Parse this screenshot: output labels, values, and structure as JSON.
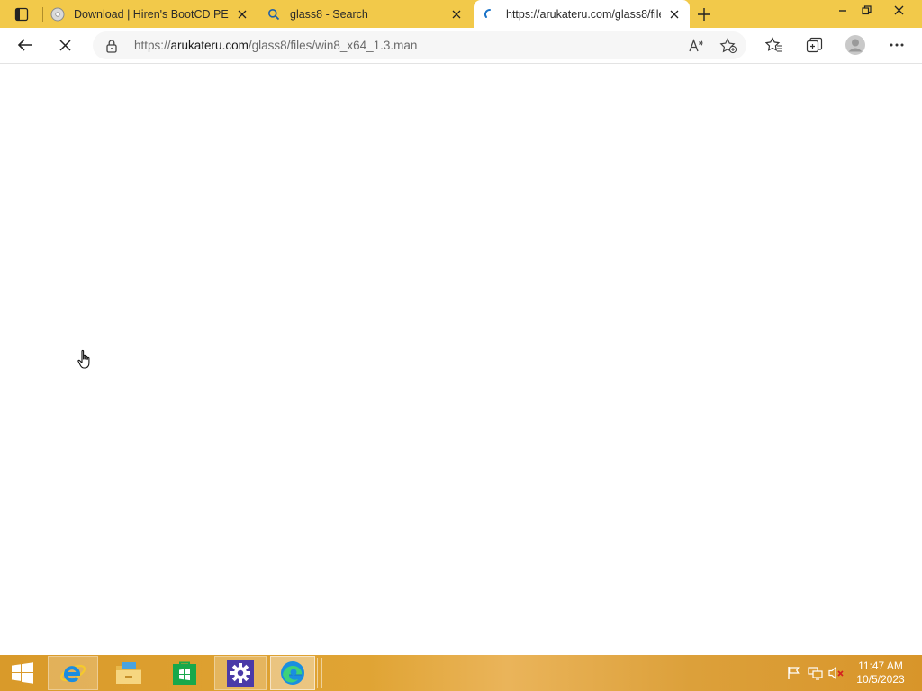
{
  "browser": {
    "tabs": [
      {
        "title": "Download | Hiren's BootCD PE",
        "favicon": "disc-icon",
        "active": false
      },
      {
        "title": "glass8 - Search",
        "favicon": "search-icon",
        "active": false
      },
      {
        "title": "https://arukateru.com/glass8/file",
        "favicon": "loading-spinner-icon",
        "active": true
      }
    ],
    "address": {
      "scheme": "https://",
      "host": "arukateru.com",
      "path": "/glass8/files/win8_x64_1.3.man"
    },
    "toolbar_icons": [
      "back-icon",
      "stop-loading-icon",
      "read-aloud-icon",
      "add-favorite-icon",
      "favorites-icon",
      "collections-icon",
      "profile-icon",
      "more-icon"
    ],
    "accent_color": "#f2c94a"
  },
  "taskbar": {
    "items": [
      "start-icon",
      "internet-explorer-icon",
      "file-explorer-icon",
      "store-icon",
      "settings-icon",
      "edge-icon"
    ],
    "tray": [
      "action-center-flag-icon",
      "network-icon",
      "volume-muted-icon"
    ],
    "clock": {
      "time": "11:47 AM",
      "date": "10/5/2023"
    }
  }
}
